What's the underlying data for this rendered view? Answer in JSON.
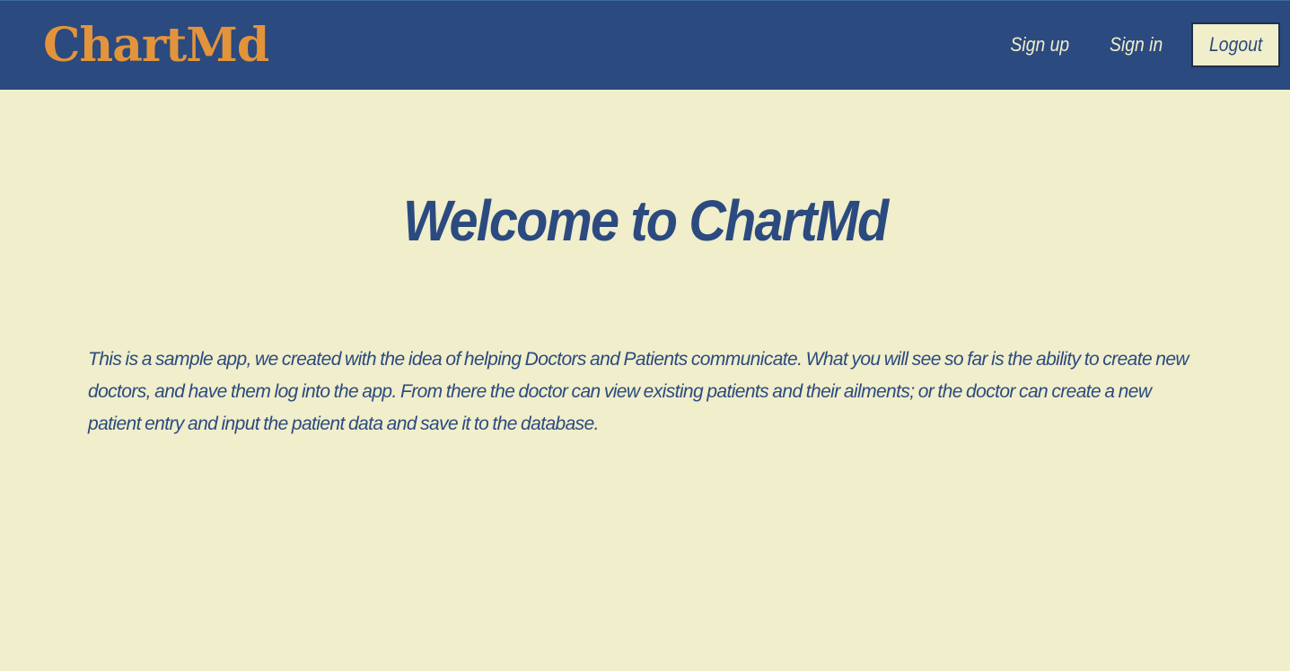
{
  "brand": {
    "name": "ChartMd"
  },
  "nav": {
    "signup_label": "Sign up",
    "signin_label": "Sign in",
    "logout_label": "Logout"
  },
  "main": {
    "heading": "Welcome to ChartMd",
    "intro": "This is a sample app, we created with the idea of helping Doctors and Patients communicate. What you will see so far is the ability to create new doctors, and have them log into the app. From there the doctor can view existing patients and their ailments; or the doctor can create a new patient entry and input the patient data and save it to the database."
  },
  "colors": {
    "navbar_bg": "#2b4a7f",
    "page_bg": "#f0eecb",
    "brand": "#e3943a",
    "text": "#2b4a7f"
  }
}
